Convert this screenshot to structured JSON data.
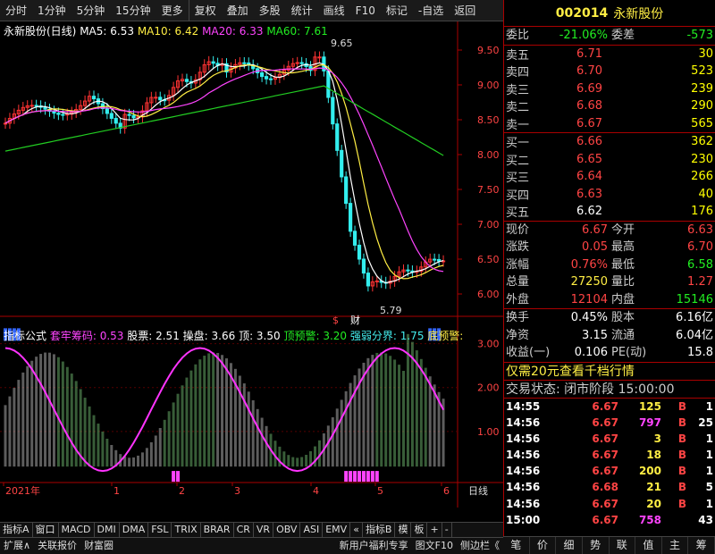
{
  "toolbar": [
    "分时",
    "1分钟",
    "5分钟",
    "15分钟",
    "更多",
    "复权",
    "叠加",
    "多股",
    "统计",
    "画线",
    "F10",
    "标记",
    "-自选",
    "返回"
  ],
  "main_legend": {
    "name": "永新股份(日线)",
    "ma5": "MA5: 6.53",
    "ma10": "MA10: 6.42",
    "ma20": "MA20: 6.33",
    "ma60": "MA60: 7.61"
  },
  "annot": {
    "high": "9.65",
    "low": "5.79",
    "s": "$",
    "cai": "财"
  },
  "price_axis": [
    "9.50",
    "9.00",
    "8.50",
    "8.00",
    "7.50",
    "7.00",
    "6.50",
    "6.00"
  ],
  "ind_legend": {
    "name": "指标公式",
    "a": "套牢筹码: 0.53",
    "b": "股票: 2.51",
    "c": "操盘: 3.66",
    "d": "顶: 3.50",
    "e": "顶预警: 3.20",
    "f": "强弱分界: 1.75",
    "g": "底预警:"
  },
  "ind_axis": [
    "3.00",
    "2.00",
    "1.00"
  ],
  "x_axis": [
    "2021年",
    "1",
    "2",
    "3",
    "4",
    "5",
    "6"
  ],
  "x_label": "日线",
  "tabs": [
    "指标A",
    "窗口",
    "MACD",
    "DMI",
    "DMA",
    "FSL",
    "TRIX",
    "BRAR",
    "CR",
    "VR",
    "OBV",
    "ASI",
    "EMV",
    "«",
    "指标B",
    "模",
    "板",
    "+",
    "-"
  ],
  "bottom": [
    "扩展∧",
    "关联报价",
    "财富圈",
    "新用户福利专享",
    "图文F10",
    "侧边栏《"
  ],
  "quote": {
    "code": "002014",
    "name": "永新股份",
    "weibi": {
      "l": "委比",
      "v": "-21.06%",
      "l2": "委差",
      "v2": "-573"
    },
    "sell": [
      [
        "卖五",
        "6.71",
        "30"
      ],
      [
        "卖四",
        "6.70",
        "523"
      ],
      [
        "卖三",
        "6.69",
        "239"
      ],
      [
        "卖二",
        "6.68",
        "290"
      ],
      [
        "卖一",
        "6.67",
        "565"
      ]
    ],
    "buy": [
      [
        "买一",
        "6.66",
        "362"
      ],
      [
        "买二",
        "6.65",
        "230"
      ],
      [
        "买三",
        "6.64",
        "266"
      ],
      [
        "买四",
        "6.63",
        "40"
      ],
      [
        "买五",
        "6.62",
        "176"
      ]
    ],
    "stats": [
      [
        "现价",
        "6.67",
        "今开",
        "6.63"
      ],
      [
        "涨跌",
        "0.05",
        "最高",
        "6.70"
      ],
      [
        "涨幅",
        "0.76%",
        "最低",
        "6.58"
      ],
      [
        "总量",
        "27250",
        "量比",
        "1.27"
      ],
      [
        "外盘",
        "12104",
        "内盘",
        "15146"
      ]
    ],
    "stats2": [
      [
        "换手",
        "0.45%",
        "股本",
        "6.16亿"
      ],
      [
        "净资",
        "3.15",
        "流通",
        "6.04亿"
      ],
      [
        "收益(一)",
        "0.106",
        "PE(动)",
        "15.8"
      ]
    ],
    "promo": "仅需20元查看千档行情",
    "status": "交易状态: 闭市阶段 15:00:00",
    "ticks": [
      [
        "14:55",
        "6.67",
        "125",
        "B",
        "1"
      ],
      [
        "14:56",
        "6.67",
        "797",
        "B",
        "25"
      ],
      [
        "14:56",
        "6.67",
        "3",
        "B",
        "1"
      ],
      [
        "14:56",
        "6.67",
        "18",
        "B",
        "1"
      ],
      [
        "14:56",
        "6.67",
        "200",
        "B",
        "1"
      ],
      [
        "14:56",
        "6.68",
        "21",
        "B",
        "5"
      ],
      [
        "14:56",
        "6.67",
        "20",
        "B",
        "1"
      ],
      [
        "15:00",
        "6.67",
        "758",
        "",
        "43"
      ]
    ],
    "tabs": [
      "笔",
      "价",
      "细",
      "势",
      "联",
      "值",
      "主",
      "筹"
    ]
  }
}
